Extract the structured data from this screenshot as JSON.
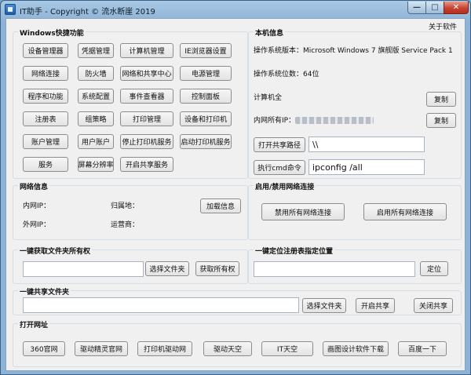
{
  "window": {
    "title": "IT助手 - Copyright © 流水断崖 2019",
    "min_glyph": "—",
    "max_glyph": "□",
    "close_glyph": "✕",
    "about": "关于软件"
  },
  "shortcuts": {
    "title": "Windows快捷功能",
    "rows": [
      [
        "设备管理器",
        "凭据管理",
        "计算机管理",
        "IE浏览器设置"
      ],
      [
        "网络连接",
        "防火墙",
        "网络和共享中心",
        "电源管理"
      ],
      [
        "程序和功能",
        "系统配置",
        "事件查看器",
        "控制面板"
      ],
      [
        "注册表",
        "组策略",
        "打印管理",
        "设备和打印机"
      ],
      [
        "账户管理",
        "用户账户",
        "停止打印机服务",
        "启动打印机服务"
      ],
      [
        "服务",
        "屏幕分辨率",
        "开启共享服务"
      ]
    ]
  },
  "local_info": {
    "title": "本机信息",
    "os_version": "操作系统版本：Microsoft Windows 7 旗舰版  Service Pack 1",
    "os_bits": "操作系统位数：64位",
    "computer_name": "计算机全",
    "copy_label": "复制",
    "intranet_ip_label": "内网所有IP：",
    "copy2_label": "复制",
    "open_share_label": "打开共享路径",
    "share_path_value": "\\\\",
    "run_cmd_label": "执行cmd命令",
    "cmd_value": "ipconfig /all"
  },
  "network_info": {
    "title": "网络信息",
    "lan_ip": "内网IP：",
    "location": "归属地：",
    "wan_ip": "外网IP：",
    "isp": "运营商：",
    "load_label": "加载信息"
  },
  "net_toggle": {
    "title": "启用/禁用网络连接",
    "disable_all": "禁用所有网络连接",
    "enable_all": "启用所有网络连接"
  },
  "ownership": {
    "title": "一键获取文件夹所有权",
    "path_value": "",
    "select_label": "选择文件夹",
    "get_label": "获取所有权"
  },
  "registry": {
    "title": "一键定位注册表指定位置",
    "path_value": "",
    "locate_label": "定位"
  },
  "share_folder": {
    "title": "一键共享文件夹",
    "path_value": "",
    "select_label": "选择文件夹",
    "enable_label": "开启共享",
    "disable_label": "关闭共享"
  },
  "urls": {
    "title": "打开网址",
    "items": [
      "360官网",
      "驱动精灵官网",
      "打印机驱动网",
      "驱动天空",
      "IT天空",
      "画图设计软件下载",
      "百度一下"
    ]
  }
}
